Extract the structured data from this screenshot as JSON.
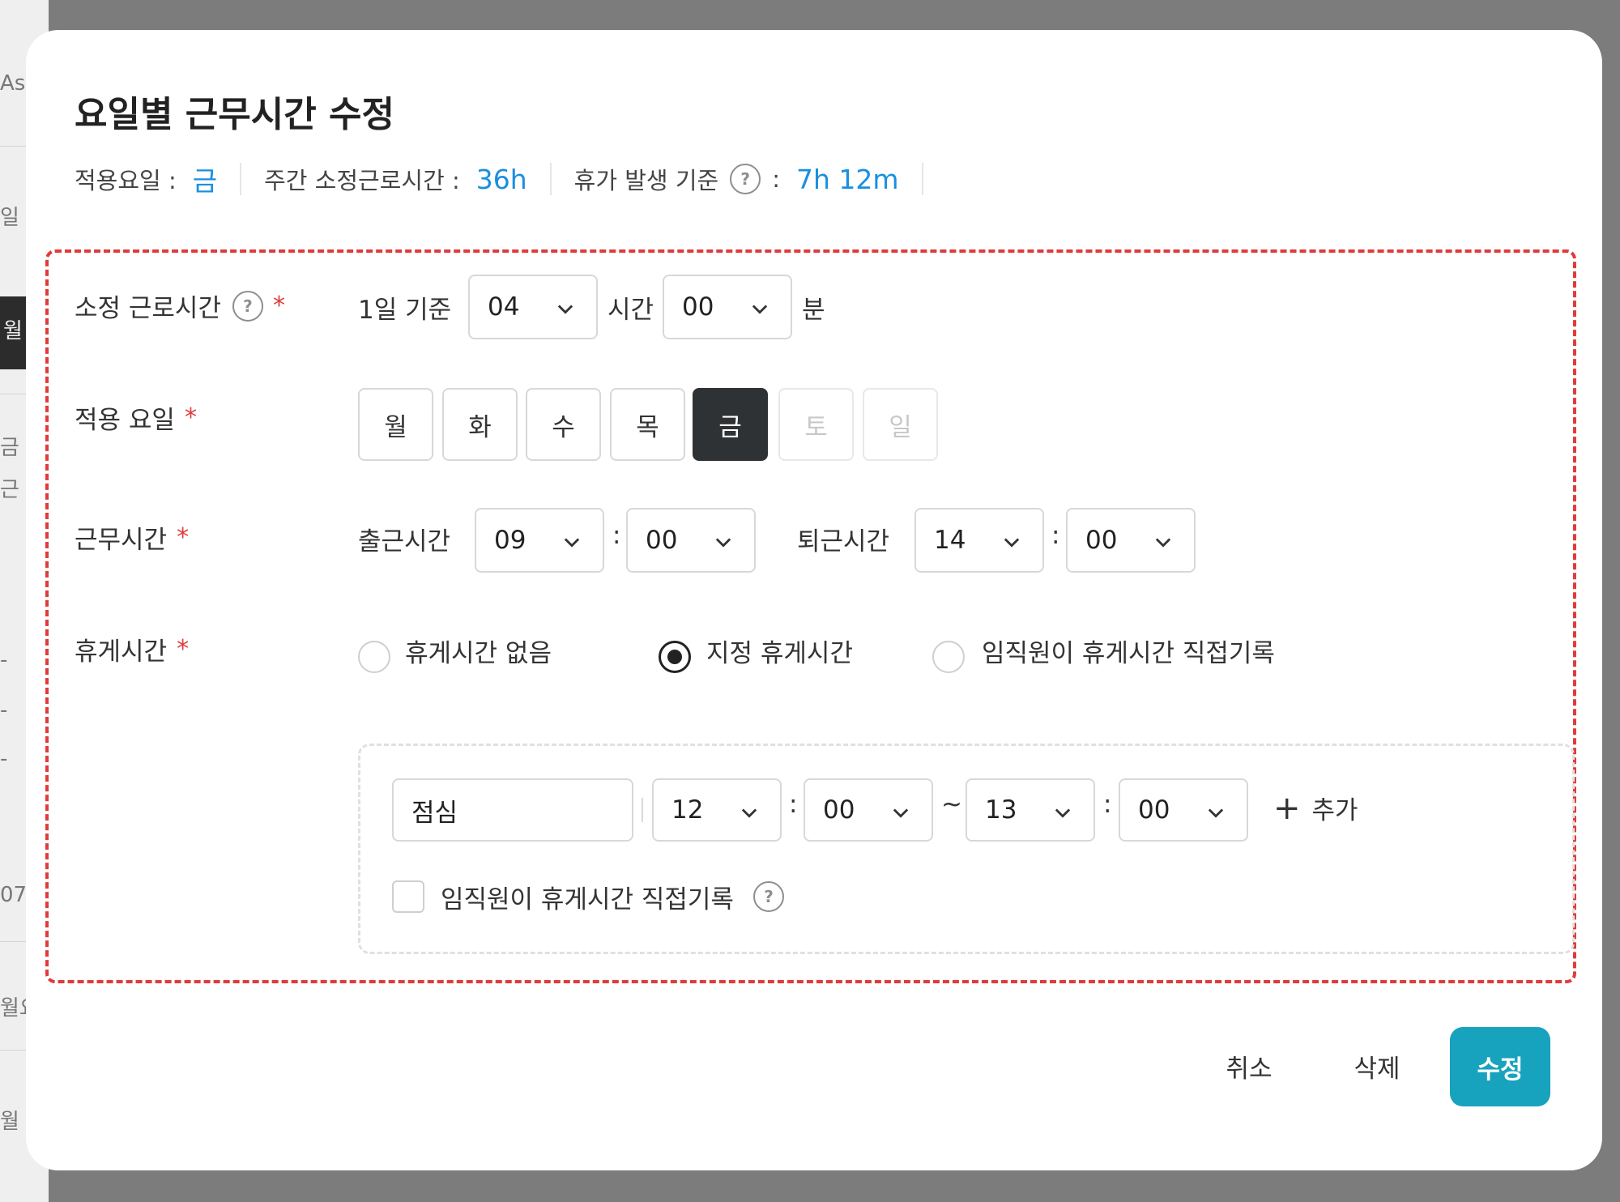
{
  "background": {
    "fragments": [
      "Asi",
      "일 ㅈ",
      "월",
      "금",
      "근",
      "-",
      "-",
      "-",
      "07",
      "월요",
      "월"
    ]
  },
  "modal": {
    "title": "요일별 근무시간 수정",
    "summary": {
      "apply_day_label": "적용요일 :",
      "apply_day_value": "금",
      "weekly_hours_label": "주간 소정근로시간 :",
      "weekly_hours_value": "36h",
      "leave_basis_label": "휴가 발생 기준",
      "leave_basis_colon": ":",
      "leave_basis_value": "7h 12m",
      "help_glyph": "?"
    },
    "contract_hours": {
      "label": "소정 근로시간",
      "required_mark": "*",
      "per_day_label": "1일 기준",
      "hours_value": "04",
      "hours_unit": "시간",
      "minutes_value": "00",
      "minutes_unit": "분"
    },
    "apply_days": {
      "label": "적용 요일",
      "required_mark": "*",
      "days": [
        "월",
        "화",
        "수",
        "목",
        "금",
        "토",
        "일"
      ],
      "selected": "금",
      "disabled": [
        "토",
        "일"
      ]
    },
    "work_time": {
      "label": "근무시간",
      "required_mark": "*",
      "start_label": "출근시간",
      "start_hour": "09",
      "start_minute": "00",
      "end_label": "퇴근시간",
      "end_hour": "14",
      "end_minute": "00",
      "colon": ":"
    },
    "break_time": {
      "label": "휴게시간",
      "required_mark": "*",
      "options": [
        "휴게시간 없음",
        "지정 휴게시간",
        "임직원이 휴게시간 직접기록"
      ],
      "selected_option": "지정 휴게시간",
      "entry": {
        "name": "점심",
        "start_hour": "12",
        "start_minute": "00",
        "tilde": "~",
        "end_hour": "13",
        "end_minute": "00"
      },
      "add_label": "추가",
      "add_plus": "+",
      "self_record_label": "임직원이 휴게시간 직접기록",
      "self_record_checked": false
    },
    "footer": {
      "cancel_label": "취소",
      "delete_label": "삭제",
      "submit_label": "수정"
    },
    "colors": {
      "accent_value": "#1a8fe0",
      "required": "#e03b3b",
      "primary_button": "#17a3bd",
      "selected_day": "#2f3234"
    }
  }
}
